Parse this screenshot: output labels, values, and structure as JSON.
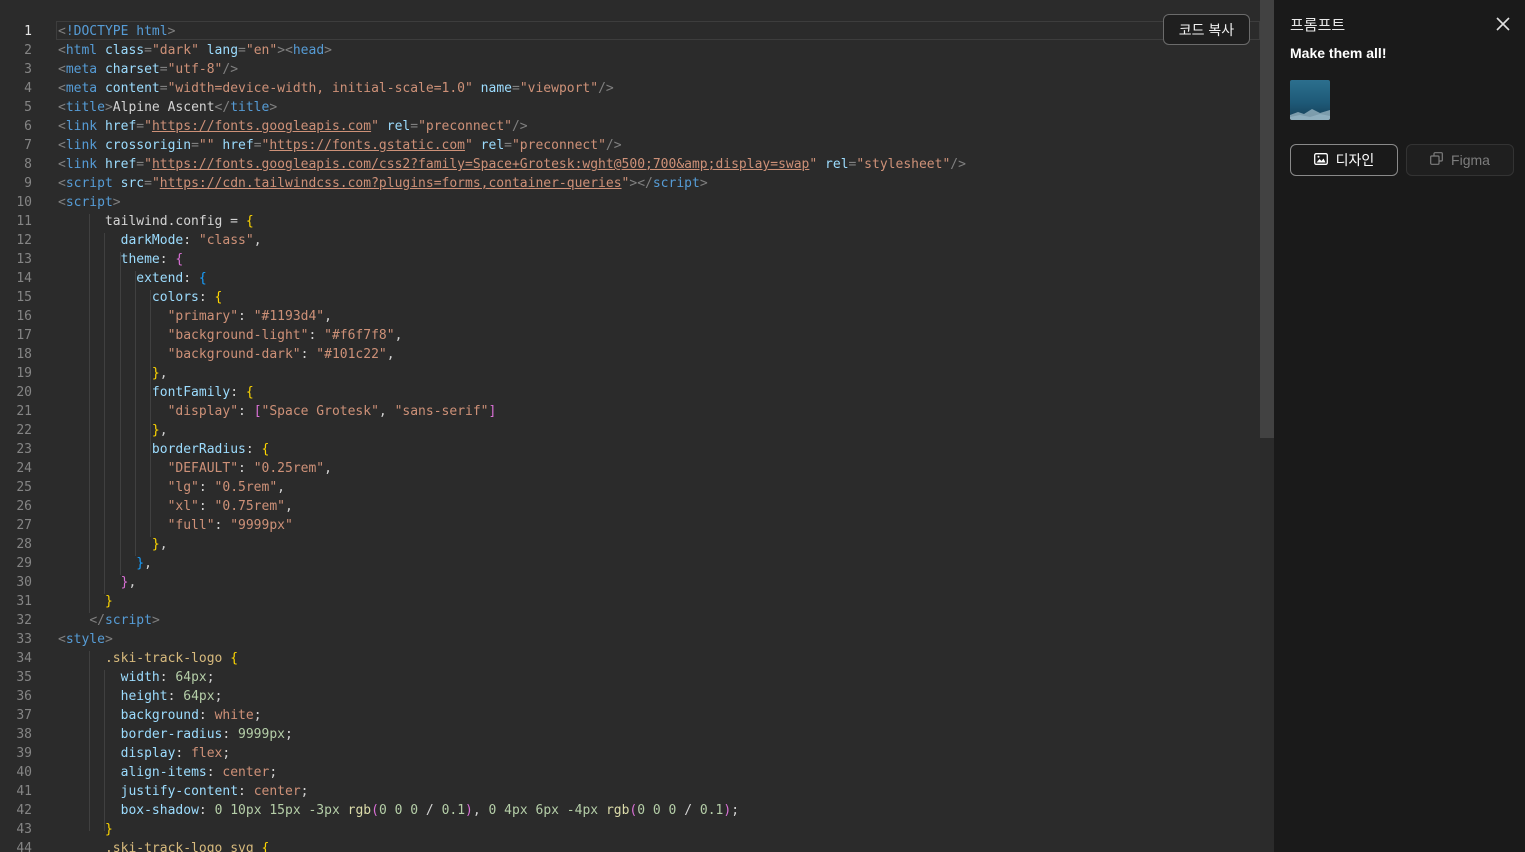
{
  "editor": {
    "active_line": 1,
    "lines": [
      [
        [
          "p",
          "<"
        ],
        [
          "tag",
          "!DOCTYPE"
        ],
        [
          "txt",
          " "
        ],
        [
          "tag",
          "html"
        ],
        [
          "p",
          ">"
        ]
      ],
      [
        [
          "p",
          "<"
        ],
        [
          "tag",
          "html"
        ],
        [
          "txt",
          " "
        ],
        [
          "attr",
          "class"
        ],
        [
          "p",
          "="
        ],
        [
          "str",
          "\"dark\""
        ],
        [
          "txt",
          " "
        ],
        [
          "attr",
          "lang"
        ],
        [
          "p",
          "="
        ],
        [
          "str",
          "\"en\""
        ],
        [
          "p",
          "><"
        ],
        [
          "tag",
          "head"
        ],
        [
          "p",
          ">"
        ]
      ],
      [
        [
          "p",
          "<"
        ],
        [
          "tag",
          "meta"
        ],
        [
          "txt",
          " "
        ],
        [
          "attr",
          "charset"
        ],
        [
          "p",
          "="
        ],
        [
          "str",
          "\"utf-8\""
        ],
        [
          "p",
          "/>"
        ]
      ],
      [
        [
          "p",
          "<"
        ],
        [
          "tag",
          "meta"
        ],
        [
          "txt",
          " "
        ],
        [
          "attr",
          "content"
        ],
        [
          "p",
          "="
        ],
        [
          "str",
          "\"width=device-width, initial-scale=1.0\""
        ],
        [
          "txt",
          " "
        ],
        [
          "attr",
          "name"
        ],
        [
          "p",
          "="
        ],
        [
          "str",
          "\"viewport\""
        ],
        [
          "p",
          "/>"
        ]
      ],
      [
        [
          "p",
          "<"
        ],
        [
          "tag",
          "title"
        ],
        [
          "p",
          ">"
        ],
        [
          "txt",
          "Alpine Ascent"
        ],
        [
          "p",
          "</"
        ],
        [
          "tag",
          "title"
        ],
        [
          "p",
          ">"
        ]
      ],
      [
        [
          "p",
          "<"
        ],
        [
          "tag",
          "link"
        ],
        [
          "txt",
          " "
        ],
        [
          "attr",
          "href"
        ],
        [
          "p",
          "="
        ],
        [
          "str",
          "\""
        ],
        [
          "url",
          "https://fonts.googleapis.com"
        ],
        [
          "str",
          "\""
        ],
        [
          "txt",
          " "
        ],
        [
          "attr",
          "rel"
        ],
        [
          "p",
          "="
        ],
        [
          "str",
          "\"preconnect\""
        ],
        [
          "p",
          "/>"
        ]
      ],
      [
        [
          "p",
          "<"
        ],
        [
          "tag",
          "link"
        ],
        [
          "txt",
          " "
        ],
        [
          "attr",
          "crossorigin"
        ],
        [
          "p",
          "="
        ],
        [
          "str",
          "\"\""
        ],
        [
          "txt",
          " "
        ],
        [
          "attr",
          "href"
        ],
        [
          "p",
          "="
        ],
        [
          "str",
          "\""
        ],
        [
          "url",
          "https://fonts.gstatic.com"
        ],
        [
          "str",
          "\""
        ],
        [
          "txt",
          " "
        ],
        [
          "attr",
          "rel"
        ],
        [
          "p",
          "="
        ],
        [
          "str",
          "\"preconnect\""
        ],
        [
          "p",
          "/>"
        ]
      ],
      [
        [
          "p",
          "<"
        ],
        [
          "tag",
          "link"
        ],
        [
          "txt",
          " "
        ],
        [
          "attr",
          "href"
        ],
        [
          "p",
          "="
        ],
        [
          "str",
          "\""
        ],
        [
          "url",
          "https://fonts.googleapis.com/css2?family=Space+Grotesk:wght@500;700&amp;display=swap"
        ],
        [
          "str",
          "\""
        ],
        [
          "txt",
          " "
        ],
        [
          "attr",
          "rel"
        ],
        [
          "p",
          "="
        ],
        [
          "str",
          "\"stylesheet\""
        ],
        [
          "p",
          "/>"
        ]
      ],
      [
        [
          "p",
          "<"
        ],
        [
          "tag",
          "script"
        ],
        [
          "txt",
          " "
        ],
        [
          "attr",
          "src"
        ],
        [
          "p",
          "="
        ],
        [
          "str",
          "\""
        ],
        [
          "url",
          "https://cdn.tailwindcss.com?plugins=forms,container-queries"
        ],
        [
          "str",
          "\""
        ],
        [
          "p",
          "></"
        ],
        [
          "tag",
          "script"
        ],
        [
          "p",
          ">"
        ]
      ],
      [
        [
          "p",
          "<"
        ],
        [
          "tag",
          "script"
        ],
        [
          "p",
          ">"
        ]
      ],
      [
        [
          "txt",
          "      tailwind.config = "
        ],
        [
          "b1",
          "{"
        ]
      ],
      [
        [
          "txt",
          "        "
        ],
        [
          "key",
          "darkMode"
        ],
        [
          "txt",
          ": "
        ],
        [
          "str",
          "\"class\""
        ],
        [
          "txt",
          ","
        ]
      ],
      [
        [
          "txt",
          "        "
        ],
        [
          "key",
          "theme"
        ],
        [
          "txt",
          ": "
        ],
        [
          "b2",
          "{"
        ]
      ],
      [
        [
          "txt",
          "          "
        ],
        [
          "key",
          "extend"
        ],
        [
          "txt",
          ": "
        ],
        [
          "b3",
          "{"
        ]
      ],
      [
        [
          "txt",
          "            "
        ],
        [
          "key",
          "colors"
        ],
        [
          "txt",
          ": "
        ],
        [
          "b1",
          "{"
        ]
      ],
      [
        [
          "txt",
          "              "
        ],
        [
          "str",
          "\"primary\""
        ],
        [
          "txt",
          ": "
        ],
        [
          "str",
          "\"#1193d4\""
        ],
        [
          "txt",
          ","
        ]
      ],
      [
        [
          "txt",
          "              "
        ],
        [
          "str",
          "\"background-light\""
        ],
        [
          "txt",
          ": "
        ],
        [
          "str",
          "\"#f6f7f8\""
        ],
        [
          "txt",
          ","
        ]
      ],
      [
        [
          "txt",
          "              "
        ],
        [
          "str",
          "\"background-dark\""
        ],
        [
          "txt",
          ": "
        ],
        [
          "str",
          "\"#101c22\""
        ],
        [
          "txt",
          ","
        ]
      ],
      [
        [
          "txt",
          "            "
        ],
        [
          "b1",
          "}"
        ],
        [
          "txt",
          ","
        ]
      ],
      [
        [
          "txt",
          "            "
        ],
        [
          "key",
          "fontFamily"
        ],
        [
          "txt",
          ": "
        ],
        [
          "b1",
          "{"
        ]
      ],
      [
        [
          "txt",
          "              "
        ],
        [
          "str",
          "\"display\""
        ],
        [
          "txt",
          ": "
        ],
        [
          "b2",
          "["
        ],
        [
          "str",
          "\"Space Grotesk\""
        ],
        [
          "txt",
          ", "
        ],
        [
          "str",
          "\"sans-serif\""
        ],
        [
          "b2",
          "]"
        ]
      ],
      [
        [
          "txt",
          "            "
        ],
        [
          "b1",
          "}"
        ],
        [
          "txt",
          ","
        ]
      ],
      [
        [
          "txt",
          "            "
        ],
        [
          "key",
          "borderRadius"
        ],
        [
          "txt",
          ": "
        ],
        [
          "b1",
          "{"
        ]
      ],
      [
        [
          "txt",
          "              "
        ],
        [
          "str",
          "\"DEFAULT\""
        ],
        [
          "txt",
          ": "
        ],
        [
          "str",
          "\"0.25rem\""
        ],
        [
          "txt",
          ","
        ]
      ],
      [
        [
          "txt",
          "              "
        ],
        [
          "str",
          "\"lg\""
        ],
        [
          "txt",
          ": "
        ],
        [
          "str",
          "\"0.5rem\""
        ],
        [
          "txt",
          ","
        ]
      ],
      [
        [
          "txt",
          "              "
        ],
        [
          "str",
          "\"xl\""
        ],
        [
          "txt",
          ": "
        ],
        [
          "str",
          "\"0.75rem\""
        ],
        [
          "txt",
          ","
        ]
      ],
      [
        [
          "txt",
          "              "
        ],
        [
          "str",
          "\"full\""
        ],
        [
          "txt",
          ": "
        ],
        [
          "str",
          "\"9999px\""
        ]
      ],
      [
        [
          "txt",
          "            "
        ],
        [
          "b1",
          "}"
        ],
        [
          "txt",
          ","
        ]
      ],
      [
        [
          "txt",
          "          "
        ],
        [
          "b3",
          "}"
        ],
        [
          "txt",
          ","
        ]
      ],
      [
        [
          "txt",
          "        "
        ],
        [
          "b2",
          "}"
        ],
        [
          "txt",
          ","
        ]
      ],
      [
        [
          "txt",
          "      "
        ],
        [
          "b1",
          "}"
        ]
      ],
      [
        [
          "txt",
          "    "
        ],
        [
          "p",
          "</"
        ],
        [
          "tag",
          "script"
        ],
        [
          "p",
          ">"
        ]
      ],
      [
        [
          "p",
          "<"
        ],
        [
          "tag",
          "style"
        ],
        [
          "p",
          ">"
        ]
      ],
      [
        [
          "txt",
          "      "
        ],
        [
          "sel",
          ".ski-track-logo"
        ],
        [
          "txt",
          " "
        ],
        [
          "b1",
          "{"
        ]
      ],
      [
        [
          "txt",
          "        "
        ],
        [
          "key",
          "width"
        ],
        [
          "txt",
          ": "
        ],
        [
          "num",
          "64px"
        ],
        [
          "txt",
          ";"
        ]
      ],
      [
        [
          "txt",
          "        "
        ],
        [
          "key",
          "height"
        ],
        [
          "txt",
          ": "
        ],
        [
          "num",
          "64px"
        ],
        [
          "txt",
          ";"
        ]
      ],
      [
        [
          "txt",
          "        "
        ],
        [
          "key",
          "background"
        ],
        [
          "txt",
          ": "
        ],
        [
          "str",
          "white"
        ],
        [
          "txt",
          ";"
        ]
      ],
      [
        [
          "txt",
          "        "
        ],
        [
          "key",
          "border-radius"
        ],
        [
          "txt",
          ": "
        ],
        [
          "num",
          "9999px"
        ],
        [
          "txt",
          ";"
        ]
      ],
      [
        [
          "txt",
          "        "
        ],
        [
          "key",
          "display"
        ],
        [
          "txt",
          ": "
        ],
        [
          "str",
          "flex"
        ],
        [
          "txt",
          ";"
        ]
      ],
      [
        [
          "txt",
          "        "
        ],
        [
          "key",
          "align-items"
        ],
        [
          "txt",
          ": "
        ],
        [
          "str",
          "center"
        ],
        [
          "txt",
          ";"
        ]
      ],
      [
        [
          "txt",
          "        "
        ],
        [
          "key",
          "justify-content"
        ],
        [
          "txt",
          ": "
        ],
        [
          "str",
          "center"
        ],
        [
          "txt",
          ";"
        ]
      ],
      [
        [
          "txt",
          "        "
        ],
        [
          "key",
          "box-shadow"
        ],
        [
          "txt",
          ": "
        ],
        [
          "num",
          "0 10px 15px -3px"
        ],
        [
          "txt",
          " "
        ],
        [
          "fn",
          "rgb"
        ],
        [
          "b2",
          "("
        ],
        [
          "num",
          "0 0 0"
        ],
        [
          "txt",
          " / "
        ],
        [
          "num",
          "0.1"
        ],
        [
          "b2",
          ")"
        ],
        [
          "txt",
          ", "
        ],
        [
          "num",
          "0 4px 6px -4px"
        ],
        [
          "txt",
          " "
        ],
        [
          "fn",
          "rgb"
        ],
        [
          "b2",
          "("
        ],
        [
          "num",
          "0 0 0"
        ],
        [
          "txt",
          " / "
        ],
        [
          "num",
          "0.1"
        ],
        [
          "b2",
          ")"
        ],
        [
          "txt",
          ";"
        ]
      ],
      [
        [
          "txt",
          "      "
        ],
        [
          "b1",
          "}"
        ]
      ],
      [
        [
          "txt",
          "      "
        ],
        [
          "sel",
          ".ski-track-logo svg"
        ],
        [
          "txt",
          " "
        ],
        [
          "b1",
          "{"
        ]
      ]
    ],
    "copy_button_label": "코드 복사"
  },
  "panel": {
    "title": "프롬프트",
    "prompt": "Make them all!",
    "design_button_label": "디자인",
    "figma_button_label": "Figma",
    "icons": {
      "close": "close-icon",
      "design": "image-icon",
      "figma": "copy-icon"
    }
  },
  "colors": {
    "editor_bg": "#2b2b2b",
    "panel_bg": "#1a1a1a",
    "tag": "#569cd6",
    "attribute": "#9cdcfe",
    "string": "#ce9178"
  }
}
